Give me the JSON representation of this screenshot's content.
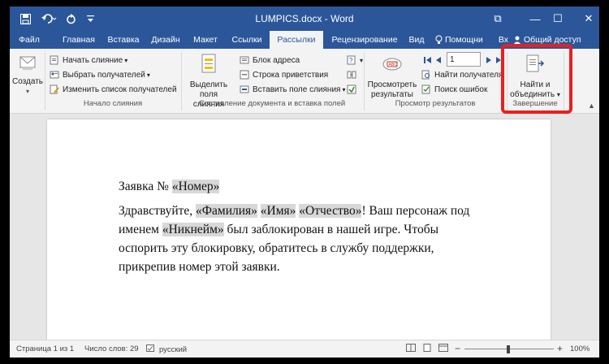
{
  "window": {
    "title": "LUMPICS.docx - Word",
    "controls": {
      "restore": "⧉",
      "minimize": "—",
      "maximize": "☐",
      "close": "✕"
    }
  },
  "qat": {
    "save_icon": "save-icon",
    "undo_icon": "undo-icon",
    "redo_icon": "redo-icon",
    "customize_icon": "customize-qat-icon"
  },
  "tabs": [
    {
      "label": "Файл"
    },
    {
      "label": "Главная"
    },
    {
      "label": "Вставка"
    },
    {
      "label": "Дизайн"
    },
    {
      "label": "Макет"
    },
    {
      "label": "Ссылки"
    },
    {
      "label": "Рассылки",
      "active": true
    },
    {
      "label": "Рецензирование"
    },
    {
      "label": "Вид"
    },
    {
      "label": "Помощни"
    },
    {
      "label": "Вх"
    },
    {
      "label": "Общий доступ"
    }
  ],
  "ribbon": {
    "create": {
      "label": "Создать"
    },
    "start_merge": {
      "group_label": "Начало слияния",
      "start": "Начать слияние",
      "select_recipients": "Выбрать получателей",
      "edit_list": "Изменить список получателей"
    },
    "write_insert": {
      "group_label": "Составление документа и вставка полей",
      "highlight_fields": "Выделить поля слияния",
      "address_block": "Блок адреса",
      "greeting_line": "Строка приветствия",
      "insert_field": "Вставить поле слияния"
    },
    "preview": {
      "group_label": "Просмотр результатов",
      "preview_results": "Просмотреть результаты",
      "record_number": "1",
      "find_recipient": "Найти получателя",
      "check_errors": "Поиск ошибок"
    },
    "finish": {
      "group_label": "Завершение",
      "find_merge": "Найти и объединить"
    }
  },
  "document": {
    "line1_prefix": "Заявка № ",
    "field_number": "«Номер»",
    "line2_prefix": "Здравствуйте, ",
    "field_last": "«Фамилия»",
    "space": " ",
    "field_first": "«Имя»",
    "field_middle": "«Отчество»",
    "line2_suffix": "! Ваш персонаж под",
    "line3_prefix": "именем ",
    "field_nick": "«Никнейм»",
    "line3_suffix": " был заблокирован в нашей игре. Чтобы",
    "line4": "оспорить эту блокировку, обратитесь в службу поддержки,",
    "line5": "прикрепив номер этой заявки."
  },
  "status": {
    "page": "Страница 1 из 1",
    "words": "Число слов: 29",
    "language": "русский",
    "zoom": "100%",
    "zoom_minus": "−",
    "zoom_plus": "+"
  },
  "colors": {
    "accent": "#2b579a",
    "highlight_box": "#e8201e",
    "field_shading": "#d8d8d8"
  }
}
